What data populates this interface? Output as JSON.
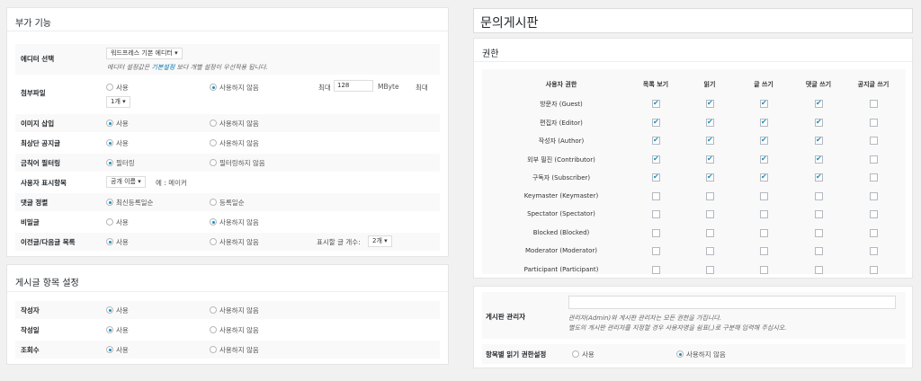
{
  "left": {
    "panel1": {
      "title": "부가 기능",
      "editor": {
        "label": "에디터 선택",
        "select": "워드프레스 기본 에디터",
        "note_pre": "에디터 설정값은 ",
        "note_link": "기본설정",
        "note_post": " 보다 개별 설정이 우선적용 됩니다."
      },
      "attach": {
        "label": "첨부파일",
        "opt_use": "사용",
        "opt_nouse": "사용하지 않음",
        "max_label": "최대",
        "max_value": "128",
        "unit": "MByte",
        "max_label2": "최대",
        "count_select": "1개"
      },
      "image": {
        "label": "이미지 삽입",
        "opt_use": "사용",
        "opt_nouse": "사용하지 않음"
      },
      "notice": {
        "label": "최상단 공지글",
        "opt_use": "사용",
        "opt_nouse": "사용하지 않음"
      },
      "filter": {
        "label": "금칙어 필터링",
        "opt_use": "필터링",
        "opt_nouse": "필터링하지 않음"
      },
      "display": {
        "label": "사용자 표시항목",
        "select": "공개 이름",
        "example": "예 : 메이커"
      },
      "comment": {
        "label": "댓글 정렬",
        "opt_a": "최신등록일순",
        "opt_b": "등록일순"
      },
      "secret": {
        "label": "비밀글",
        "opt_use": "사용",
        "opt_nouse": "사용하지 않음"
      },
      "prevnext": {
        "label": "이전글/다음글 목록",
        "opt_use": "사용",
        "opt_nouse": "사용하지 않음",
        "count_label": "표시할 글 개수:",
        "count_select": "2개"
      }
    },
    "panel2": {
      "title": "게시글 항목 설정",
      "rows": [
        {
          "label": "작성자",
          "opt_use": "사용",
          "opt_nouse": "사용하지 않음"
        },
        {
          "label": "작성일",
          "opt_use": "사용",
          "opt_nouse": "사용하지 않음"
        },
        {
          "label": "조회수",
          "opt_use": "사용",
          "opt_nouse": "사용하지 않음"
        }
      ]
    }
  },
  "right": {
    "page_title": "문의게시판",
    "perm_title": "권한",
    "headers": [
      "사용자 권한",
      "목록 보기",
      "읽기",
      "글 쓰기",
      "댓글 쓰기",
      "공지글 쓰기"
    ],
    "roles": [
      {
        "name": "방문자 (Guest)",
        "checks": [
          true,
          true,
          true,
          true,
          false
        ]
      },
      {
        "name": "편집자 (Editor)",
        "checks": [
          true,
          true,
          true,
          true,
          false
        ]
      },
      {
        "name": "작성자 (Author)",
        "checks": [
          true,
          true,
          true,
          true,
          false
        ]
      },
      {
        "name": "외부 필진 (Contributor)",
        "checks": [
          true,
          true,
          true,
          true,
          false
        ]
      },
      {
        "name": "구독자 (Subscriber)",
        "checks": [
          true,
          true,
          true,
          true,
          false
        ]
      },
      {
        "name": "Keymaster (Keymaster)",
        "checks": [
          false,
          false,
          false,
          false,
          false
        ]
      },
      {
        "name": "Spectator (Spectator)",
        "checks": [
          false,
          false,
          false,
          false,
          false
        ]
      },
      {
        "name": "Blocked (Blocked)",
        "checks": [
          false,
          false,
          false,
          false,
          false
        ]
      },
      {
        "name": "Moderator (Moderator)",
        "checks": [
          false,
          false,
          false,
          false,
          false
        ]
      },
      {
        "name": "Participant (Participant)",
        "checks": [
          false,
          false,
          false,
          false,
          false
        ]
      }
    ],
    "admin": {
      "label": "게시판 관리자",
      "value": "",
      "note1": "관리자(Admin)와 게시판 관리자는 모든 권한을 가집니다.",
      "note2": "별도의 게시판 관리자를 지정할 경우 사용자명을 쉼표(,)로 구분해 입력해 주십시오."
    },
    "itemread": {
      "label": "항목별 읽기 권한설정",
      "opt_use": "사용",
      "opt_nouse": "사용하지 않음"
    }
  }
}
